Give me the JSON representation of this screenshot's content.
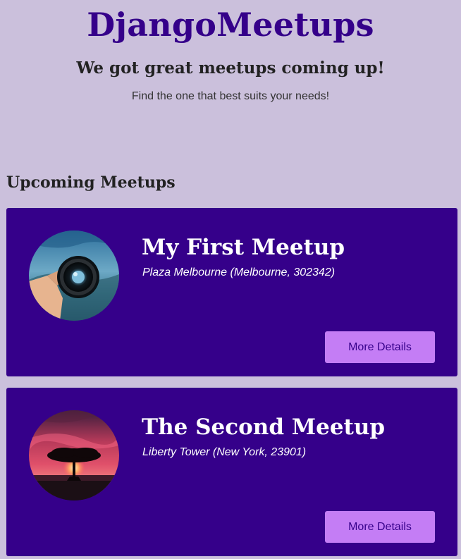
{
  "header": {
    "site_title": "DjangoMeetups",
    "tagline": "We got great meetups coming up!",
    "subtitle": "Find the one that best suits your needs!"
  },
  "main": {
    "section_heading": "Upcoming Meetups",
    "meetups": [
      {
        "title": "My First Meetup",
        "address": "Plaza Melbourne (Melbourne, 302342)",
        "button_label": "More Details",
        "image": "camera-lens-photo"
      },
      {
        "title": "The Second Meetup",
        "address": "Liberty Tower (New York, 23901)",
        "button_label": "More Details",
        "image": "sunset-tree-photo"
      }
    ]
  },
  "colors": {
    "background": "#cbc0dc",
    "brand": "#35008a",
    "button": "#c47df5",
    "heading_text": "#222222"
  }
}
